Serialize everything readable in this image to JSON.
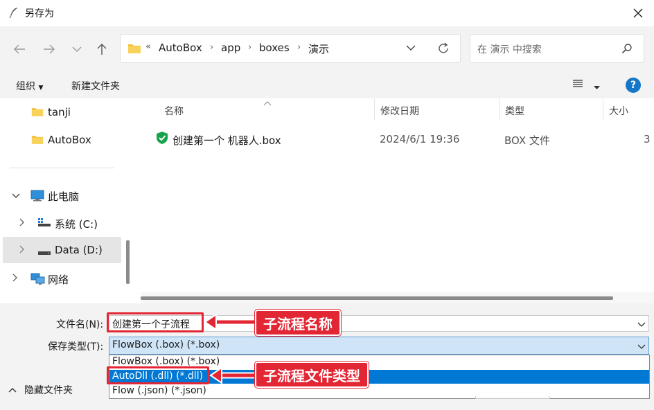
{
  "window": {
    "title": "另存为"
  },
  "address": {
    "crumbs": [
      "AutoBox",
      "app",
      "boxes",
      "演示"
    ],
    "overflow": "«"
  },
  "search": {
    "placeholder": "在 演示 中搜索"
  },
  "toolbar": {
    "organize": "组织",
    "new_folder": "新建文件夹",
    "help": "?"
  },
  "nav": {
    "items": [
      {
        "label": "tanji",
        "icon": "folder-icon"
      },
      {
        "label": "AutoBox",
        "icon": "folder-icon"
      },
      {
        "label": "此电脑",
        "icon": "computer-icon"
      },
      {
        "label": "系统 (C:)",
        "icon": "drive-icon"
      },
      {
        "label": "Data (D:)",
        "icon": "drive-icon"
      },
      {
        "label": "网络",
        "icon": "network-icon"
      }
    ]
  },
  "files": {
    "columns": [
      "名称",
      "修改日期",
      "类型",
      "大小"
    ],
    "rows": [
      {
        "name": "创建第一个 机器人.box",
        "date": "2024/6/1 19:36",
        "type": "BOX 文件",
        "size": "3"
      }
    ]
  },
  "form": {
    "filename_label": "文件名(N):",
    "filename_value": "创建第一个子流程",
    "filetype_label": "保存类型(T):",
    "filetype_value": "FlowBox (.box) (*.box)",
    "filetype_options": [
      "FlowBox (.box) (*.box)",
      "AutoDll (.dll) (*.dll)",
      "Flow (.json) (*.json)"
    ],
    "filetype_selected_index": 1,
    "hide_folders": "隐藏文件夹"
  },
  "annotations": {
    "name_callout": "子流程名称",
    "type_callout": "子流程文件类型"
  },
  "colors": {
    "accent": "#0078d4",
    "annotation": "#e32634",
    "shield": "#16a34a"
  }
}
